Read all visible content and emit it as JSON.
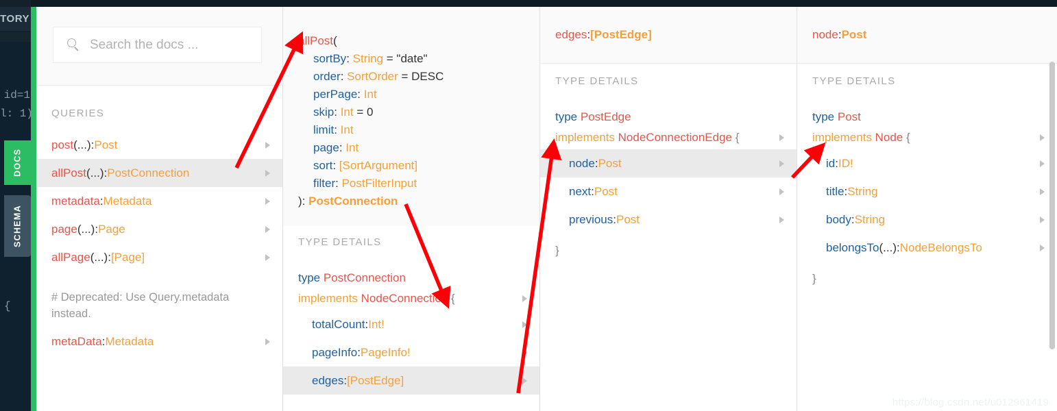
{
  "editor": {
    "history_tab": "TORY",
    "code_lines": [
      "id=1",
      "l: 1)",
      "{"
    ]
  },
  "vertical_tabs": [
    {
      "label": "DOCS",
      "active": true
    },
    {
      "label": "SCHEMA",
      "active": false
    }
  ],
  "search": {
    "placeholder": "Search the docs ...",
    "icon": "search-icon"
  },
  "columns": [
    {
      "section_title": "QUERIES",
      "rows": [
        {
          "name": "post",
          "args": "(...)",
          "sep": ": ",
          "type": "Post",
          "selected": false,
          "expand": true
        },
        {
          "name": "allPost",
          "args": "(...)",
          "sep": ": ",
          "type": "PostConnection",
          "selected": true,
          "expand": true
        },
        {
          "name": "metadata",
          "args": "",
          "sep": ": ",
          "type": "Metadata",
          "selected": false,
          "expand": true
        },
        {
          "name": "page",
          "args": "(...)",
          "sep": ": ",
          "type": "Page",
          "selected": false,
          "expand": true
        },
        {
          "name": "allPage",
          "args": "(...)",
          "sep": ": ",
          "type": "[Page]",
          "selected": false,
          "expand": true
        }
      ],
      "comment": "# Deprecated: Use Query.metadata instead.",
      "deprecated_row": {
        "name": "metaData",
        "args": "",
        "sep": ": ",
        "type": "Metadata",
        "selected": false,
        "expand": true
      }
    },
    {
      "signature": {
        "fn_name": "allPost",
        "open_paren": "(",
        "args": [
          {
            "name": "sortBy",
            "type": "String",
            "default": " = \"date\""
          },
          {
            "name": "order",
            "type": "SortOrder",
            "default": " = DESC"
          },
          {
            "name": "perPage",
            "type": "Int",
            "default": ""
          },
          {
            "name": "skip",
            "type": "Int",
            "default": " = 0"
          },
          {
            "name": "limit",
            "type": "Int",
            "default": ""
          },
          {
            "name": "page",
            "type": "Int",
            "default": ""
          },
          {
            "name": "sort",
            "type": "[SortArgument]",
            "default": ""
          },
          {
            "name": "filter",
            "type": "PostFilterInput",
            "default": ""
          }
        ],
        "close": "): ",
        "return_type": "PostConnection"
      },
      "section_title": "TYPE DETAILS",
      "type_kw": "type",
      "type_name": "PostConnection",
      "implements_kw": "implements",
      "implements_name": "NodeConnection",
      "open_brace": "{",
      "close_brace": "}",
      "fields": [
        {
          "name": "totalCount",
          "sep": ": ",
          "type": "Int!",
          "selected": false,
          "expand": true
        },
        {
          "name": "pageInfo",
          "sep": ": ",
          "type": "PageInfo!",
          "selected": false,
          "expand": true
        },
        {
          "name": "edges",
          "sep": ": ",
          "type": "[PostEdge]",
          "selected": true,
          "expand": true
        }
      ]
    },
    {
      "header": {
        "name": "edges",
        "sep": ": ",
        "type": "[PostEdge]"
      },
      "section_title": "TYPE DETAILS",
      "type_kw": "type",
      "type_name": "PostEdge",
      "implements_kw": "implements",
      "implements_name": "NodeConnectionEdge",
      "open_brace": "{",
      "close_brace": "}",
      "fields": [
        {
          "name": "node",
          "sep": ": ",
          "type": "Post",
          "selected": true,
          "expand": true
        },
        {
          "name": "next",
          "sep": ": ",
          "type": "Post",
          "selected": false,
          "expand": true
        },
        {
          "name": "previous",
          "sep": ": ",
          "type": "Post",
          "selected": false,
          "expand": true
        }
      ]
    },
    {
      "header": {
        "name": "node",
        "sep": ": ",
        "type": "Post"
      },
      "section_title": "TYPE DETAILS",
      "type_kw": "type",
      "type_name": "Post",
      "implements_kw": "implements",
      "implements_name": "Node",
      "open_brace": "{",
      "close_brace": "}",
      "fields": [
        {
          "name": "id",
          "sep": ": ",
          "type": "ID!",
          "selected": false,
          "expand": true
        },
        {
          "name": "title",
          "sep": ": ",
          "type": "String",
          "selected": false,
          "expand": true
        },
        {
          "name": "body",
          "sep": ": ",
          "type": "String",
          "selected": false,
          "expand": true
        },
        {
          "name": "belongsTo",
          "args": "(...)",
          "sep": ": ",
          "type": "NodeBelongsTo",
          "selected": false,
          "expand": true
        }
      ]
    }
  ],
  "watermark": "https://blog.csdn.net/u012961419",
  "accent_colors": {
    "green": "#2cbc63",
    "field_blue": "#1f61a0",
    "type_orange": "#f2a03d",
    "name_red": "#e2574c",
    "annotation_red": "#fb0007",
    "selected_row": "#eaeaea",
    "editor_dark": "#0f212e"
  }
}
